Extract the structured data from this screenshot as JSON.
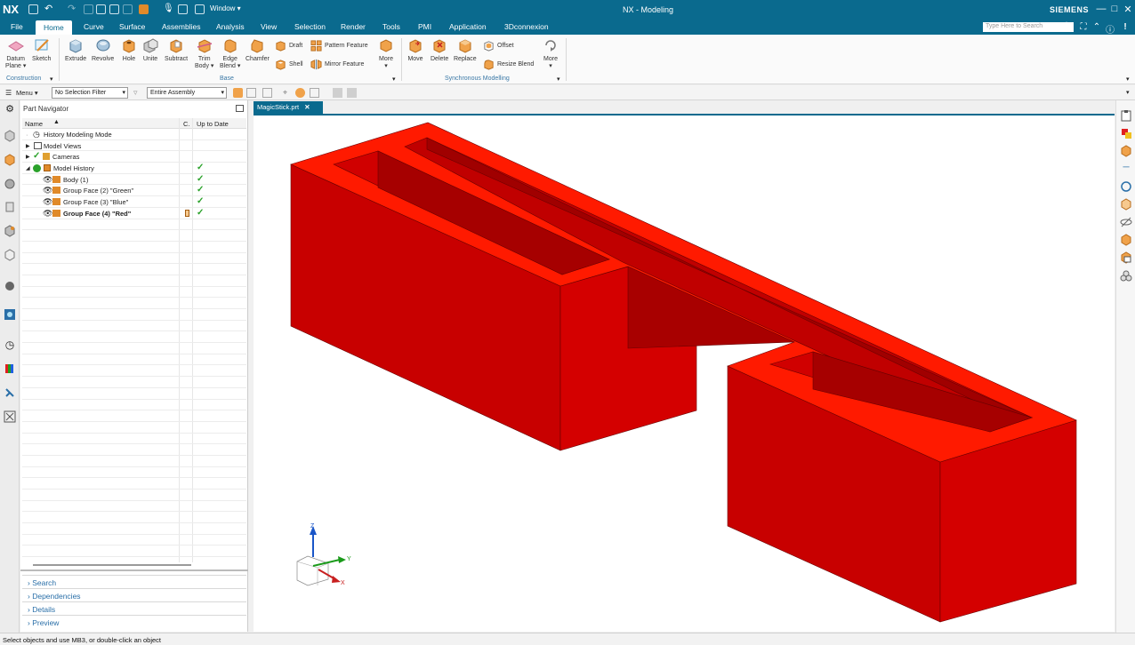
{
  "titlebar": {
    "logo": "NX",
    "window_menu": "Window ▾",
    "title": "NX - Modeling",
    "brand": "SIEMENS",
    "minimize": "—",
    "restore": "□",
    "close": "✕"
  },
  "tabs": [
    "File",
    "Home",
    "Curve",
    "Surface",
    "Assemblies",
    "Analysis",
    "View",
    "Selection",
    "Render",
    "Tools",
    "PMI",
    "Application",
    "3Dconnexion"
  ],
  "search": {
    "placeholder": "Type Here to Search"
  },
  "ribbon": {
    "construction": {
      "datum_plane": "Datum\nPlane ▾",
      "sketch": "Sketch",
      "group": "Construction"
    },
    "base": {
      "extrude": "Extrude",
      "revolve": "Revolve",
      "hole": "Hole",
      "unite": "Unite",
      "subtract": "Subtract",
      "trim_body": "Trim\nBody ▾",
      "edge_blend": "Edge\nBlend ▾",
      "chamfer": "Chamfer",
      "draft": "Draft",
      "shell": "Shell",
      "pattern_feature": "Pattern Feature",
      "mirror_feature": "Mirror Feature",
      "more": "More",
      "group": "Base"
    },
    "sync": {
      "move": "Move",
      "delete": "Delete",
      "replace": "Replace",
      "offset": "Offset",
      "resize_blend": "Resize Blend",
      "more": "More",
      "group": "Synchronous Modelling"
    }
  },
  "selection_bar": {
    "menu": "Menu ▾",
    "filter": "No Selection Filter",
    "scope": "Entire Assembly"
  },
  "part_navigator": {
    "title": "Part Navigator",
    "columns": {
      "name": "Name",
      "c": "C.",
      "up_to_date": "Up to Date"
    },
    "rows": [
      {
        "label": "History Modeling Mode",
        "uptodate": ""
      },
      {
        "label": "Model Views",
        "uptodate": ""
      },
      {
        "label": "Cameras",
        "uptodate": ""
      },
      {
        "label": "Model History",
        "uptodate": "✓"
      },
      {
        "label": "Body (1)",
        "uptodate": "✓"
      },
      {
        "label": "Group Face (2) \"Green\"",
        "uptodate": "✓"
      },
      {
        "label": "Group Face (3) \"Blue\"",
        "uptodate": "✓"
      },
      {
        "label": "Group Face (4) \"Red\"",
        "uptodate": "✓"
      }
    ],
    "panels": [
      "Search",
      "Dependencies",
      "Details",
      "Preview"
    ]
  },
  "document_tab": {
    "label": "MagicStick.prt",
    "close": "✕"
  },
  "triad": {
    "z": "Z",
    "y": "Y",
    "x": "X"
  },
  "status": {
    "message": "Select objects and use MB3, or double-click an object"
  },
  "colors": {
    "accent": "#0a6a8e",
    "part_top": "#ff1a00",
    "part_side": "#c40000",
    "check": "#2aa12a"
  }
}
